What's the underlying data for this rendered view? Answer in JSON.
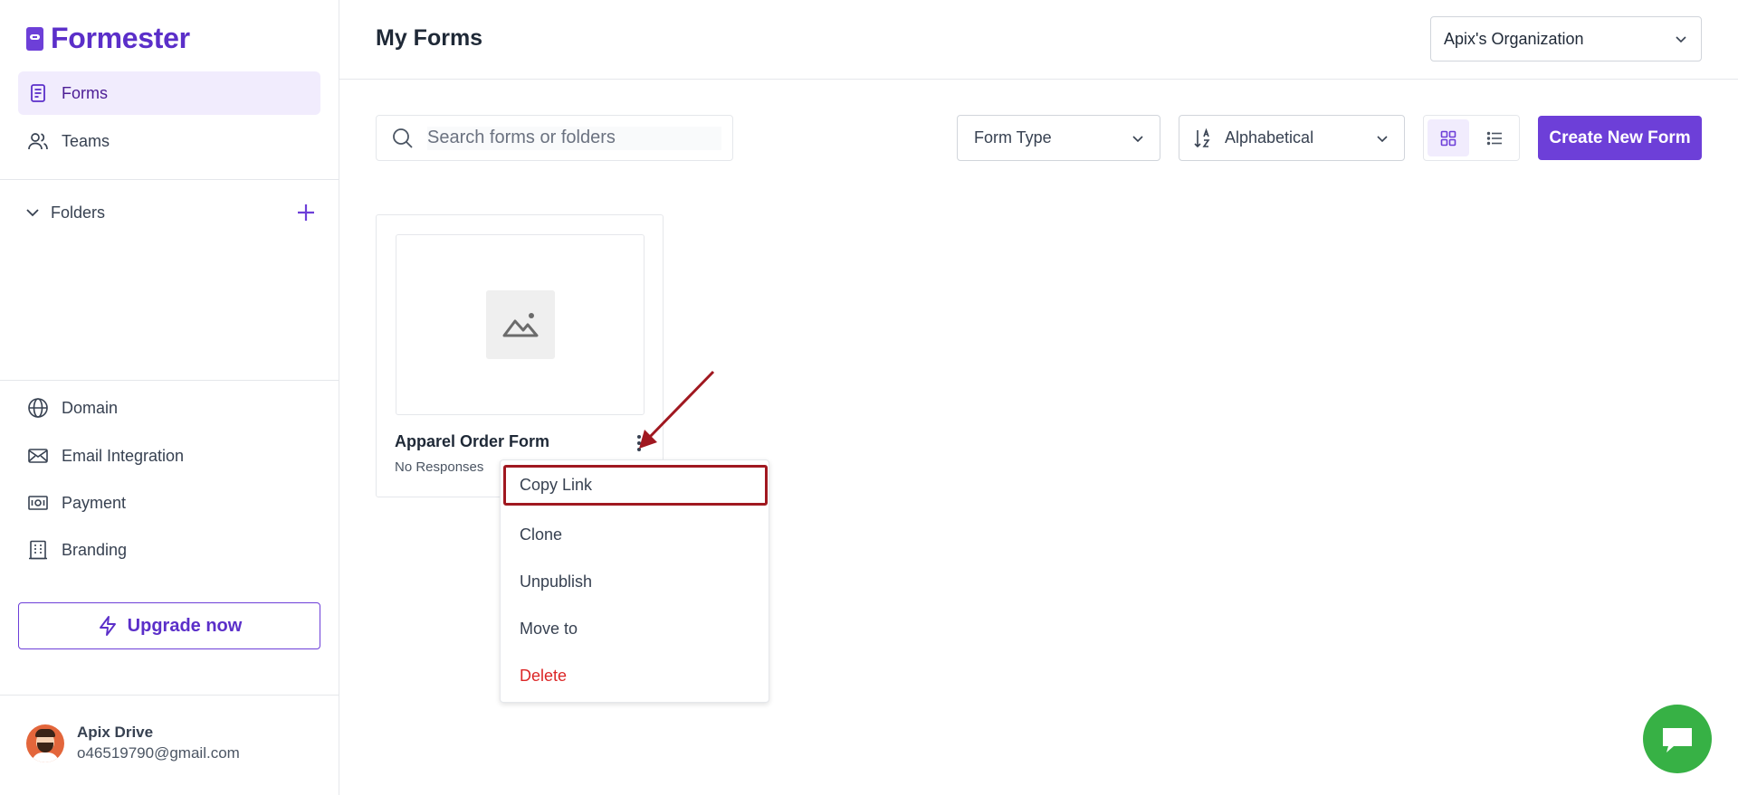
{
  "brand": {
    "name": "Formester",
    "accent": "#6d3fd8"
  },
  "sidebar": {
    "nav": [
      {
        "label": "Forms",
        "icon": "form-icon",
        "active": true
      },
      {
        "label": "Teams",
        "icon": "users-icon",
        "active": false
      }
    ],
    "folders_label": "Folders",
    "settings": [
      {
        "label": "Domain",
        "icon": "globe-icon"
      },
      {
        "label": "Email Integration",
        "icon": "mail-icon"
      },
      {
        "label": "Payment",
        "icon": "payment-icon"
      },
      {
        "label": "Branding",
        "icon": "branding-icon"
      }
    ],
    "upgrade_label": "Upgrade now",
    "user": {
      "name": "Apix Drive",
      "email": "o46519790@gmail.com"
    }
  },
  "header": {
    "title": "My Forms",
    "org_select": "Apix's Organization"
  },
  "toolbar": {
    "search_placeholder": "Search forms or folders",
    "form_type": "Form Type",
    "sort": "Alphabetical",
    "view_mode": "grid",
    "create_label": "Create New Form"
  },
  "forms": [
    {
      "title": "Apparel Order Form",
      "subtitle": "No Responses"
    }
  ],
  "context_menu": {
    "items": [
      {
        "label": "Copy Link",
        "highlighted": true
      },
      {
        "label": "Clone"
      },
      {
        "label": "Unpublish"
      },
      {
        "label": "Move to"
      },
      {
        "label": "Delete",
        "danger": true
      }
    ]
  },
  "colors": {
    "danger": "#dc2626",
    "annotation": "#a01820",
    "chat": "#37b145"
  }
}
